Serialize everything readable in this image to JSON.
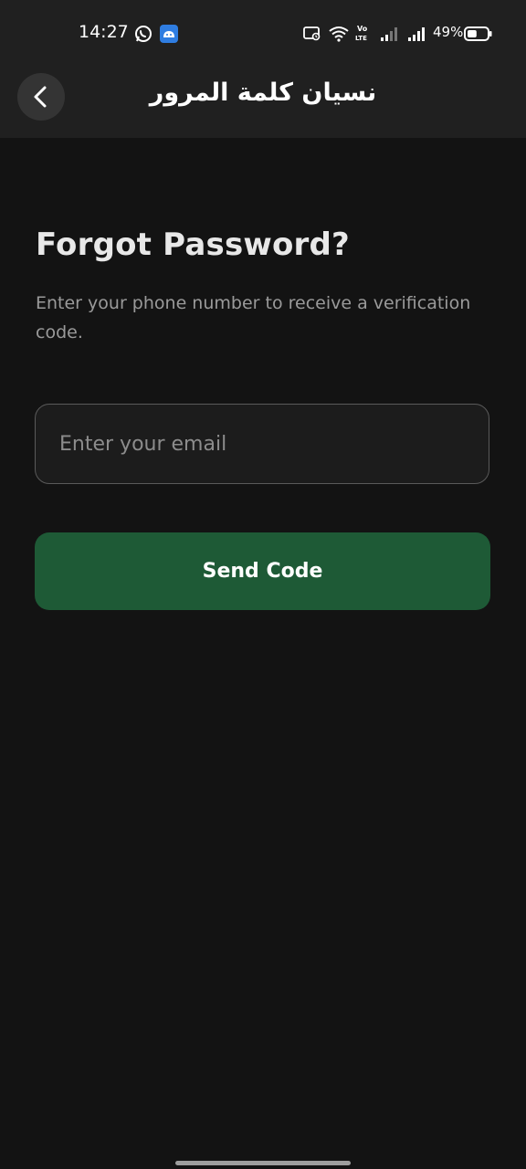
{
  "status_bar": {
    "time": "14:27",
    "battery_percent": "49%",
    "left_icons": [
      "whatsapp-icon",
      "android-notification-icon"
    ],
    "right_icons": [
      "cast-icon",
      "wifi-icon",
      "volte-icon",
      "signal-icon",
      "signal-icon",
      "battery-icon"
    ],
    "battery_level": 0.49
  },
  "app_bar": {
    "title": "نسيان كلمة المرور",
    "back_icon": "chevron-left-icon"
  },
  "main": {
    "heading": "Forgot Password?",
    "subtitle": "Enter your phone number to receive a verification code.",
    "email_input": {
      "placeholder": "Enter your email",
      "value": ""
    },
    "send_button": {
      "label": "Send Code"
    }
  },
  "colors": {
    "background": "#131313",
    "app_bar": "#202020",
    "accent_button": "#1e5a36",
    "input_border": "#5a5a5a"
  }
}
